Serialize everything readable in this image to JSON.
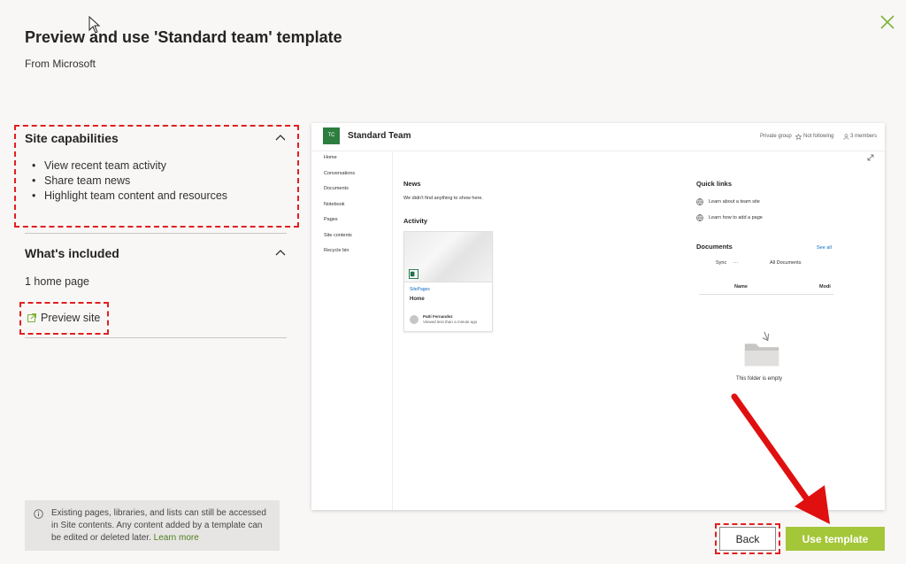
{
  "dialog": {
    "title": "Preview and use 'Standard team' template",
    "subtitle": "From Microsoft"
  },
  "site_capabilities": {
    "heading": "Site capabilities",
    "items": [
      "View recent team activity",
      "Share team news",
      "Highlight team content and resources"
    ]
  },
  "whats_included": {
    "heading": "What's included",
    "home_page": "1 home page",
    "preview_link": "Preview site"
  },
  "info": {
    "text": "Existing pages, libraries, and lists can still be accessed in Site contents. Any content added by a template can be edited or deleted later.",
    "link": "Learn more"
  },
  "preview": {
    "logo": "TC",
    "site_name": "Standard Team",
    "privacy": "Private group",
    "follow": "Not following",
    "members": "3 members",
    "nav": [
      "Home",
      "Conversations",
      "Documents",
      "Notebook",
      "Pages",
      "Site contents",
      "Recycle bin"
    ],
    "news_heading": "News",
    "news_empty": "We didn't find anything to show here.",
    "activity_heading": "Activity",
    "card_library": "SitePages",
    "card_title": "Home",
    "card_author": "Patti Fernandez",
    "card_time": "Viewed less than a minute ago",
    "quick_links_heading": "Quick links",
    "quick_links": [
      "Learn about a team site",
      "Learn how to add a page"
    ],
    "documents_heading": "Documents",
    "see_all": "See all",
    "sync": "Sync",
    "more": "···",
    "all_documents": "All Documents",
    "col_name": "Name",
    "col_modified": "Modi",
    "folder_empty": "This folder is empty"
  },
  "buttons": {
    "back": "Back",
    "use_template": "Use template"
  },
  "colors": {
    "accent": "#a4c639",
    "annotation": "#e02020",
    "site_logo": "#2d7d3e"
  }
}
